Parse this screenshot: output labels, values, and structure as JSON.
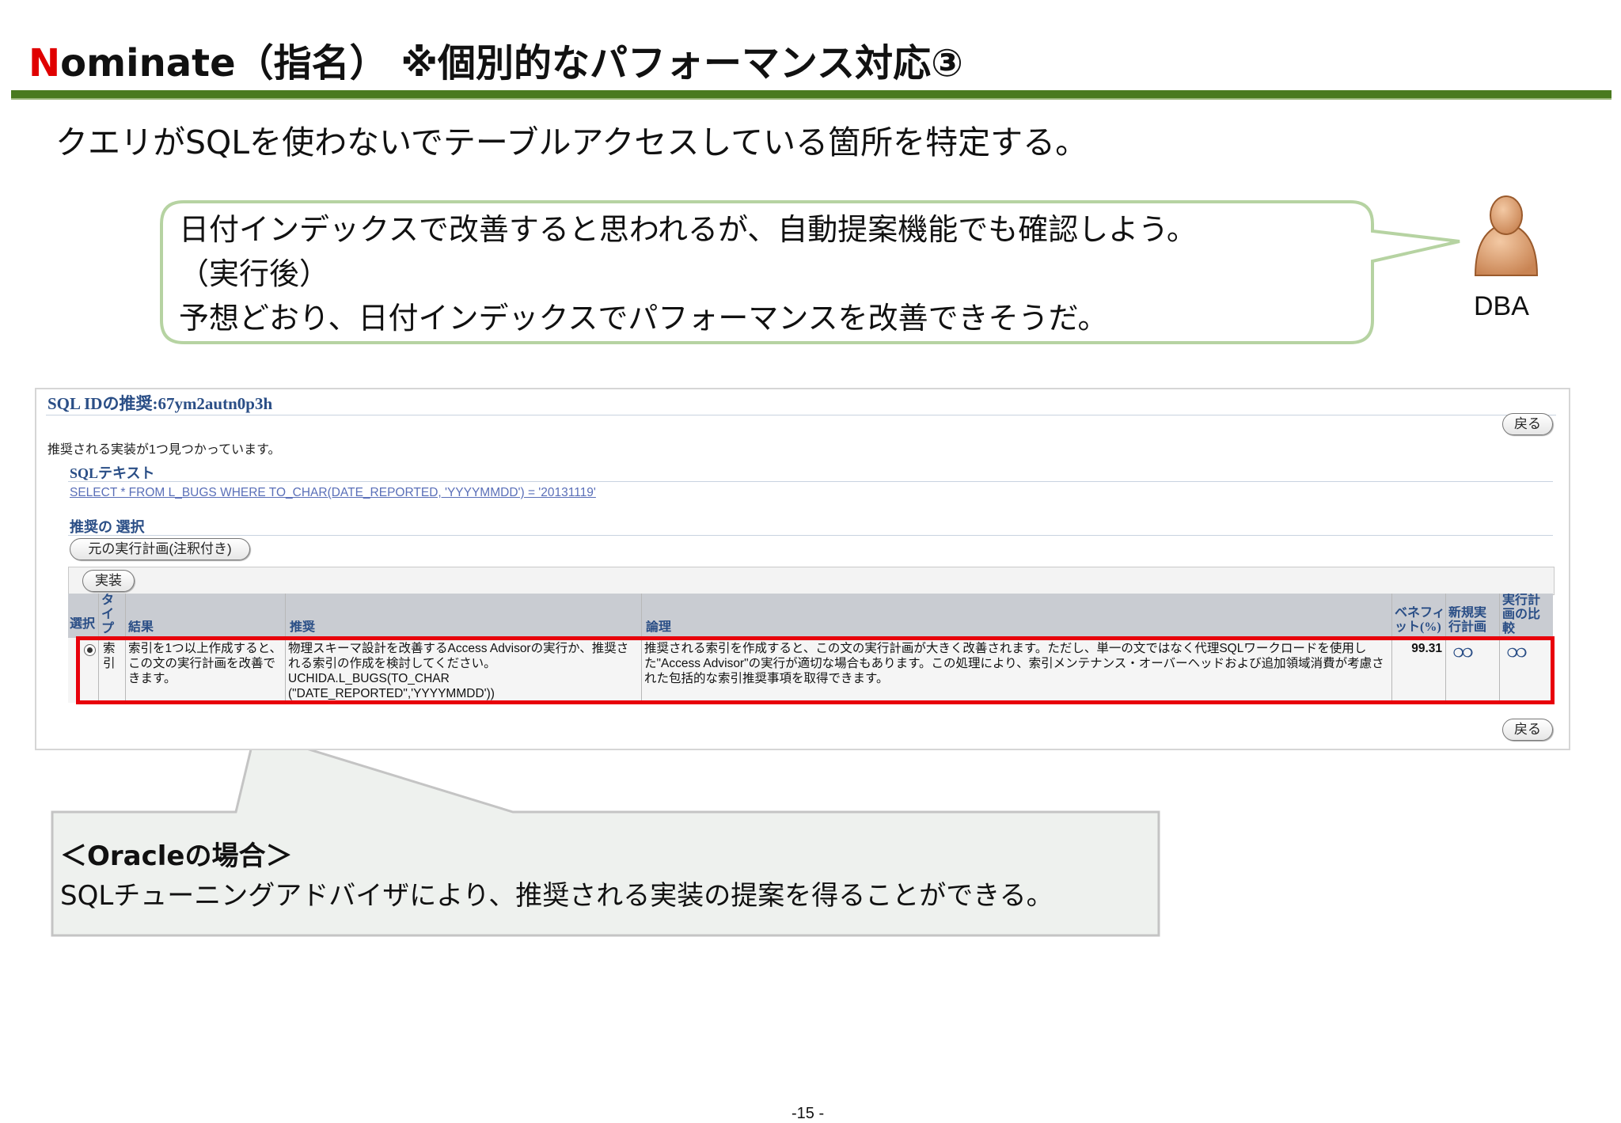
{
  "slide": {
    "title_first_letter": "N",
    "title_rest": "ominate（指名） ※個別的なパフォーマンス対応③",
    "subtitle": "クエリがSQLを使わないでテーブルアクセスしている箇所を特定する。",
    "accent_red": "#e00000",
    "rule_green": "#4a7a1f",
    "page_number": "-15 -"
  },
  "bubble": {
    "line1": "日付インデックスで改善すると思われるが、自動提案機能でも確認しよう。",
    "line2": "（実行後）",
    "line3": "予想どおり、日付インデックスでパフォーマンスを改善できそうだ。",
    "speaker": "DBA"
  },
  "oracle_panel": {
    "title": "SQL IDの推奨:67ym2autn0p3h",
    "back_label": "戻る",
    "found_text": "推奨される実装が1つ見つかっています。",
    "sql_text_heading": "SQLテキスト",
    "sql_text": "SELECT * FROM L_BUGS WHERE TO_CHAR(DATE_REPORTED, 'YYYYMMDD') = '20131119'",
    "recommendation_heading": "推奨の 選択",
    "original_plan_button": "元の実行計画(注釈付き)",
    "implement_button": "実装",
    "columns": {
      "select": "選択",
      "type": "タイプ",
      "result": "結果",
      "recommendation": "推奨",
      "rationale": "論理",
      "benefit": "ベネフィット(%)",
      "new_plan": "新規実行計画",
      "compare_plan": "実行計画の比較"
    },
    "row": {
      "type": "索引",
      "result": "索引を1つ以上作成すると、この文の実行計画を改善できます。",
      "recommendation": "物理スキーマ設計を改善するAccess Advisorの実行か、推奨される索引の作成を検討してください。 UCHIDA.L_BUGS(TO_CHAR (\"DATE_REPORTED\",'YYYYMMDD'))",
      "rationale": "推奨される索引を作成すると、この文の実行計画が大きく改善されます。ただし、単一の文ではなく代理SQLワークロードを使用した\"Access Advisor\"の実行が適切な場合もあります。この処理により、索引メンテナンス・オーバーヘッドおよび追加領域消費が考慮された包括的な索引推奨事項を取得できます。",
      "benefit": "99.31",
      "new_plan_icon": "glasses-icon",
      "compare_icon": "glasses-icon"
    },
    "highlight_color": "#e8000b"
  },
  "note": {
    "heading": "＜Oracleの場合＞",
    "body": "SQLチューニングアドバイザにより、推奨される実装の提案を得ることができる。"
  }
}
